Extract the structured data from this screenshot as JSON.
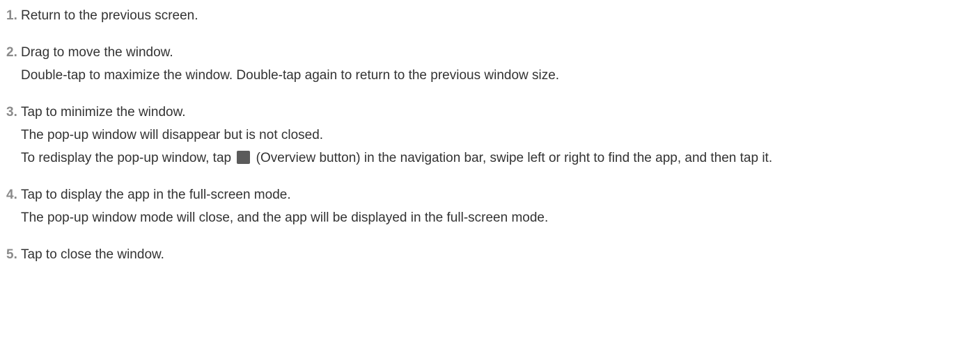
{
  "items": [
    {
      "number": "1.",
      "lines": [
        "Return to the previous screen."
      ]
    },
    {
      "number": "2.",
      "lines": [
        "Drag to move the window.",
        "Double-tap to maximize the window. Double-tap again to return to the previous window size."
      ]
    },
    {
      "number": "3.",
      "lines": [
        "Tap to minimize the window.",
        "The pop-up window will disappear but is not closed."
      ],
      "redisplay": {
        "before": "To redisplay the pop-up window, tap",
        "icon": "overview-button-icon",
        "after": "(Overview button) in the navigation bar, swipe left or right to find the app, and then tap it."
      }
    },
    {
      "number": "4.",
      "lines": [
        "Tap to display the app in the full-screen mode.",
        "The pop-up window mode will close, and the app will be displayed in the full-screen mode."
      ]
    },
    {
      "number": "5.",
      "lines": [
        "Tap to close the window."
      ]
    }
  ]
}
